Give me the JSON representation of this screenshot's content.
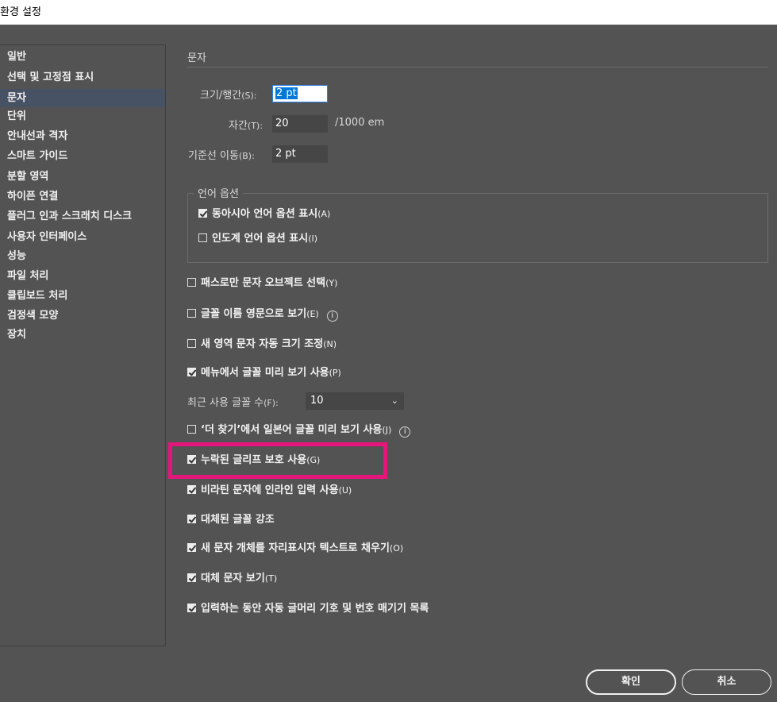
{
  "window": {
    "title": "환경 설정"
  },
  "sidebar": {
    "items": [
      {
        "label": "일반",
        "selected": false
      },
      {
        "label": "선택 및 고정점 표시",
        "selected": false
      },
      {
        "label": "문자",
        "selected": true
      },
      {
        "label": "단위",
        "selected": false
      },
      {
        "label": "안내선과 격자",
        "selected": false
      },
      {
        "label": "스마트 가이드",
        "selected": false
      },
      {
        "label": "분할 영역",
        "selected": false
      },
      {
        "label": "하이픈 연결",
        "selected": false
      },
      {
        "label": "플러그 인과 스크래치 디스크",
        "selected": false
      },
      {
        "label": "사용자 인터페이스",
        "selected": false
      },
      {
        "label": "성능",
        "selected": false
      },
      {
        "label": "파일 처리",
        "selected": false
      },
      {
        "label": "클립보드 처리",
        "selected": false
      },
      {
        "label": "검정색 모양",
        "selected": false
      },
      {
        "label": "장치",
        "selected": false
      }
    ]
  },
  "main": {
    "section_title": "문자",
    "size_leading": {
      "label": "크기/행간",
      "shortcut": "(S):",
      "value": "2 pt"
    },
    "tracking": {
      "label": "자간",
      "shortcut": "(T):",
      "value": "20",
      "unit": "/1000 em"
    },
    "baseline_shift": {
      "label": "기준선 이동",
      "shortcut": "(B):",
      "value": "2 pt"
    },
    "language_options": {
      "title": "언어 옵션",
      "east_asian": {
        "label": "동아시아 언어 옵션 표시",
        "shortcut": "(A)",
        "checked": true
      },
      "indic": {
        "label": "인도계 언어 옵션 표시",
        "shortcut": "(I)",
        "checked": false
      }
    },
    "checkboxes": {
      "type_object_path_only": {
        "label": "패스로만 문자 오브젝트 선택",
        "shortcut": "(Y)",
        "checked": false
      },
      "font_names_english": {
        "label": "글꼴 이름 영문으로 보기",
        "shortcut": "(E)",
        "checked": false,
        "info": "i"
      },
      "auto_size_area_type": {
        "label": "새 영역 문자 자동 크기 조정",
        "shortcut": "(N)",
        "checked": false
      },
      "font_preview_menu": {
        "label": "메뉴에서 글꼴 미리 보기 사용",
        "shortcut": "(P)",
        "checked": true
      },
      "japanese_font_preview": {
        "label": "‘더 찾기’에서 일본어 글꼴 미리 보기 사용",
        "shortcut": "(J)",
        "checked": false,
        "info": "i"
      },
      "missing_glyph_protection": {
        "label": "누락된 글리프 보호 사용",
        "shortcut": "(G)",
        "checked": true
      },
      "inline_input_non_latin": {
        "label": "비라틴 문자에 인라인 입력 사용",
        "shortcut": "(U)",
        "checked": true
      },
      "highlight_substituted_fonts": {
        "label": "대체된 글꼴 강조",
        "shortcut": "",
        "checked": true
      },
      "fill_with_placeholder": {
        "label": "새 문자 개체를 자리표시자 텍스트로 채우기",
        "shortcut": "(O)",
        "checked": true
      },
      "show_alternate_glyphs": {
        "label": "대체 문자 보기",
        "shortcut": "(T)",
        "checked": true
      },
      "auto_bullet_numbering": {
        "label": "입력하는 동안 자동 글머리 기호 및 번호 매기기 목록",
        "shortcut": "",
        "checked": true
      }
    },
    "recent_fonts": {
      "label": "최근 사용 글꼴 수",
      "shortcut": "(F):",
      "value": "10"
    }
  },
  "footer": {
    "ok_label": "확인",
    "cancel_label": "취소"
  },
  "colors": {
    "background": "#535353",
    "selected": "#485265",
    "highlight": "#e5157c"
  }
}
